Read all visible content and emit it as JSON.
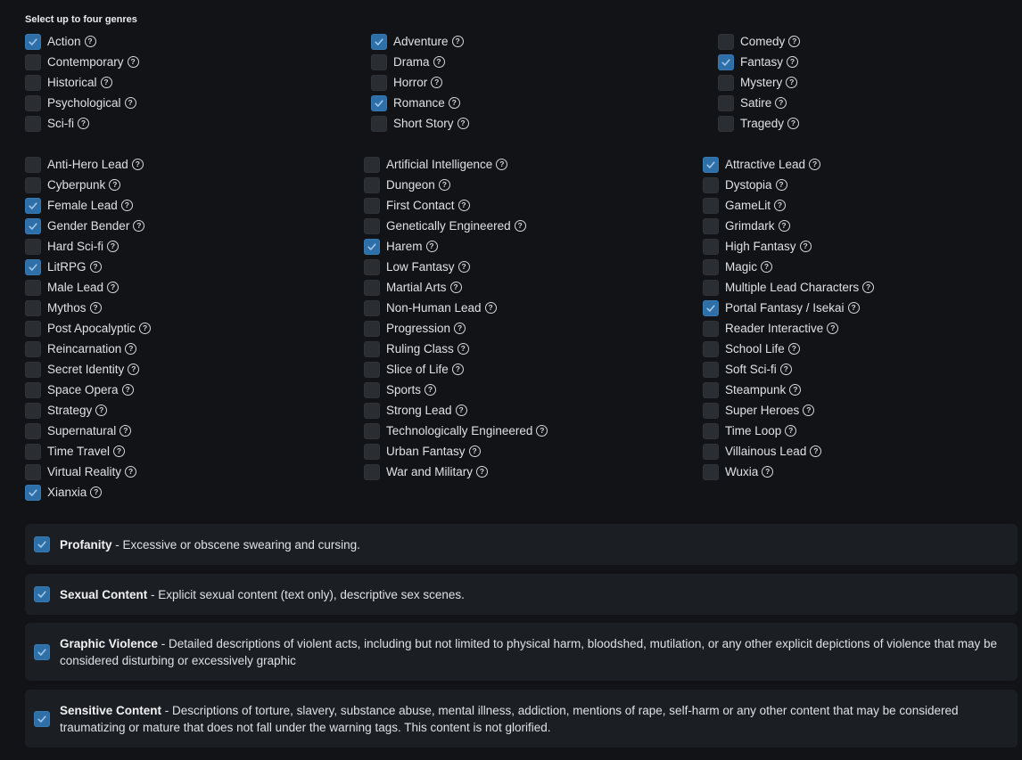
{
  "heading": "Select up to four genres",
  "genres": [
    [
      {
        "label": "Action",
        "checked": true
      },
      {
        "label": "Contemporary",
        "checked": false
      },
      {
        "label": "Historical",
        "checked": false
      },
      {
        "label": "Psychological",
        "checked": false
      },
      {
        "label": "Sci-fi",
        "checked": false
      }
    ],
    [
      {
        "label": "Adventure",
        "checked": true
      },
      {
        "label": "Drama",
        "checked": false
      },
      {
        "label": "Horror",
        "checked": false
      },
      {
        "label": "Romance",
        "checked": true
      },
      {
        "label": "Short Story",
        "checked": false
      }
    ],
    [
      {
        "label": "Comedy",
        "checked": false
      },
      {
        "label": "Fantasy",
        "checked": true
      },
      {
        "label": "Mystery",
        "checked": false
      },
      {
        "label": "Satire",
        "checked": false
      },
      {
        "label": "Tragedy",
        "checked": false
      }
    ]
  ],
  "tags": [
    [
      {
        "label": "Anti-Hero Lead",
        "checked": false
      },
      {
        "label": "Cyberpunk",
        "checked": false
      },
      {
        "label": "Female Lead",
        "checked": true
      },
      {
        "label": "Gender Bender",
        "checked": true
      },
      {
        "label": "Hard Sci-fi",
        "checked": false
      },
      {
        "label": "LitRPG",
        "checked": true
      },
      {
        "label": "Male Lead",
        "checked": false
      },
      {
        "label": "Mythos",
        "checked": false
      },
      {
        "label": "Post Apocalyptic",
        "checked": false
      },
      {
        "label": "Reincarnation",
        "checked": false
      },
      {
        "label": "Secret Identity",
        "checked": false
      },
      {
        "label": "Space Opera",
        "checked": false
      },
      {
        "label": "Strategy",
        "checked": false
      },
      {
        "label": "Supernatural",
        "checked": false
      },
      {
        "label": "Time Travel",
        "checked": false
      },
      {
        "label": "Virtual Reality",
        "checked": false
      },
      {
        "label": "Xianxia",
        "checked": true
      }
    ],
    [
      {
        "label": "Artificial Intelligence",
        "checked": false
      },
      {
        "label": "Dungeon",
        "checked": false
      },
      {
        "label": "First Contact",
        "checked": false
      },
      {
        "label": "Genetically Engineered",
        "checked": false
      },
      {
        "label": "Harem",
        "checked": true
      },
      {
        "label": "Low Fantasy",
        "checked": false
      },
      {
        "label": "Martial Arts",
        "checked": false
      },
      {
        "label": "Non-Human Lead",
        "checked": false
      },
      {
        "label": "Progression",
        "checked": false
      },
      {
        "label": "Ruling Class",
        "checked": false
      },
      {
        "label": "Slice of Life",
        "checked": false
      },
      {
        "label": "Sports",
        "checked": false
      },
      {
        "label": "Strong Lead",
        "checked": false
      },
      {
        "label": "Technologically Engineered",
        "checked": false
      },
      {
        "label": "Urban Fantasy",
        "checked": false
      },
      {
        "label": "War and Military",
        "checked": false
      }
    ],
    [
      {
        "label": "Attractive Lead",
        "checked": true
      },
      {
        "label": "Dystopia",
        "checked": false
      },
      {
        "label": "GameLit",
        "checked": false
      },
      {
        "label": "Grimdark",
        "checked": false
      },
      {
        "label": "High Fantasy",
        "checked": false
      },
      {
        "label": "Magic",
        "checked": false
      },
      {
        "label": "Multiple Lead Characters",
        "checked": false
      },
      {
        "label": "Portal Fantasy / Isekai",
        "checked": true
      },
      {
        "label": "Reader Interactive",
        "checked": false
      },
      {
        "label": "School Life",
        "checked": false
      },
      {
        "label": "Soft Sci-fi",
        "checked": false
      },
      {
        "label": "Steampunk",
        "checked": false
      },
      {
        "label": "Super Heroes",
        "checked": false
      },
      {
        "label": "Time Loop",
        "checked": false
      },
      {
        "label": "Villainous Lead",
        "checked": false
      },
      {
        "label": "Wuxia",
        "checked": false
      }
    ]
  ],
  "warnings": [
    {
      "title": "Profanity",
      "text": "Excessive or obscene swearing and cursing.",
      "checked": true
    },
    {
      "title": "Sexual Content",
      "text": "Explicit sexual content (text only), descriptive sex scenes.",
      "checked": true
    },
    {
      "title": "Graphic Violence",
      "text": "Detailed descriptions of violent acts, including but not limited to physical harm, bloodshed, mutilation, or any other explicit depictions of violence that may be considered disturbing or excessively graphic",
      "checked": true
    },
    {
      "title": "Sensitive Content",
      "text": "Descriptions of torture, slavery, substance abuse, mental illness, addiction, mentions of rape, self-harm or any other content that may be considered traumatizing or mature that does not fall under the warning tags. This content is not glorified.",
      "checked": true
    }
  ],
  "help_glyph": "?",
  "separator": " - ",
  "colors": {
    "background": "#111316",
    "checked": "#2f6fa8",
    "unchecked": "#2a2d31",
    "panel": "#1b1e22"
  }
}
